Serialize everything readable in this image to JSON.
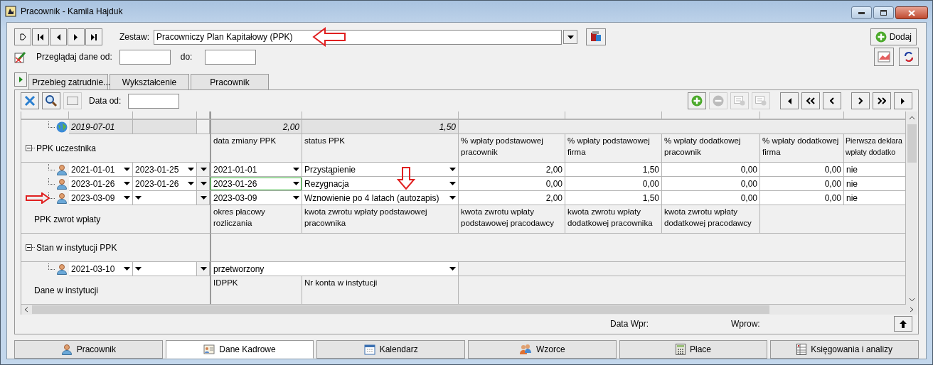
{
  "window": {
    "title": "Pracownik - Kamila Hajduk"
  },
  "zestaw": {
    "label": "Zestaw:",
    "value": "Pracowniczy Plan Kapitałowy (PPK)"
  },
  "add_button": {
    "label": "Dodaj"
  },
  "browse": {
    "label": "Przeglądaj dane od:",
    "to_label": "do:"
  },
  "top_tabs": [
    {
      "label": "Przebieg zatrudnie...",
      "selected": false
    },
    {
      "label": "Wykształcenie",
      "selected": false
    },
    {
      "label": "Pracownik",
      "selected": false
    }
  ],
  "grid_toolbar": {
    "date_label": "Data od:",
    "actions": [
      {
        "disabled": false
      },
      {
        "disabled": true
      },
      {
        "disabled": true
      },
      {
        "disabled": true
      }
    ]
  },
  "grid": {
    "summary": {
      "date": "2019-07-01",
      "values": [
        "2,00",
        "1,50"
      ]
    },
    "sections": [
      {
        "label": "PPK uczestnika",
        "expanded": true,
        "headers": [
          "data zmiany PPK",
          "status PPK",
          "% wpłaty podstawowej pracownik",
          "% wpłaty podstawowej firma",
          "% wpłaty dodatkowej pracownik",
          "% wpłaty dodatkowej firma",
          "Pierwsza deklara wpłaty dodatko"
        ],
        "rows": [
          {
            "kind": "ppk",
            "from": "2021-01-01",
            "to": "2023-01-25",
            "date": "2021-01-01",
            "status": "Przystąpienie",
            "values": [
              "2,00",
              "1,50",
              "0,00",
              "0,00"
            ],
            "first": "nie",
            "focused": false
          },
          {
            "kind": "ppk",
            "from": "2023-01-26",
            "to": "2023-01-26",
            "date": "2023-01-26",
            "status": "Rezygnacja",
            "values": [
              "0,00",
              "0,00",
              "0,00",
              "0,00"
            ],
            "first": "nie",
            "focused": true
          },
          {
            "kind": "ppk",
            "from": "2023-03-09",
            "date": "2023-03-09",
            "status": "Wznowienie po 4 latach (autozapis)",
            "values": [
              "2,00",
              "1,50",
              "0,00",
              "0,00"
            ],
            "first": "nie",
            "focused": false
          }
        ]
      },
      {
        "label": "PPK zwrot wpłaty",
        "headers": [
          "okres płacowy rozliczania",
          "kwota zwrotu wpłaty podstawowej pracownika",
          "kwota zwrotu wpłaty podstawowej pracodawcy",
          "kwota zwrotu wpłaty dodatkowej pracownika",
          "kwota zwrotu wpłaty dodatkowej pracodawcy"
        ]
      },
      {
        "label": "Stan w instytucji PPK",
        "expanded": true,
        "rows": [
          {
            "kind": "status",
            "from": "2021-03-10",
            "status": "przetworzony"
          }
        ]
      },
      {
        "label": "Dane w instytucji",
        "headers": [
          "IDPPK",
          "Nr konta w instytucji"
        ]
      }
    ]
  },
  "footer": {
    "labels": [
      "Data Wpr:",
      "Wprow:"
    ]
  },
  "bottom_tabs": [
    {
      "label": "Pracownik",
      "selected": false
    },
    {
      "label": "Dane Kadrowe",
      "selected": true
    },
    {
      "label": "Kalendarz",
      "selected": false
    },
    {
      "label": "Wzorce",
      "selected": false
    },
    {
      "label": "Płace",
      "selected": false
    },
    {
      "label": "Księgowania i analizy",
      "selected": false
    }
  ]
}
